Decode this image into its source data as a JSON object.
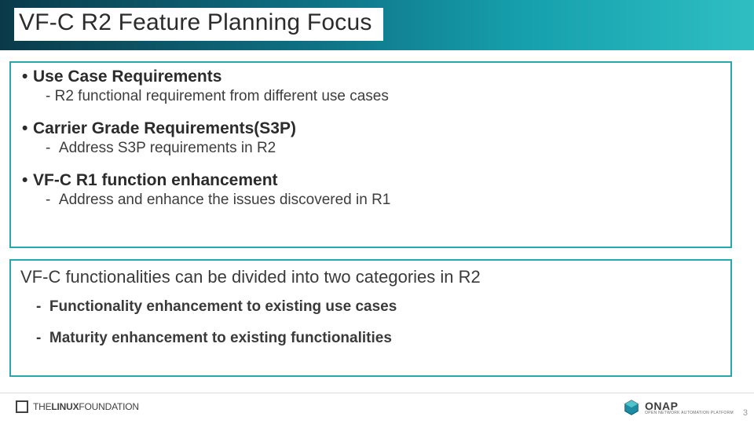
{
  "title": "VF-C R2 Feature Planning Focus",
  "sections": [
    {
      "heading": "Use Case Requirements",
      "sub": "R2 functional requirement from different use cases"
    },
    {
      "heading": "Carrier Grade Requirements(S3P)",
      "sub": "Address S3P requirements in R2"
    },
    {
      "heading": "VF-C R1 function enhancement",
      "sub": "Address and enhance the issues discovered in R1"
    }
  ],
  "categories": {
    "intro": "VF-C functionalities can be divided into two categories in R2",
    "items": [
      "Functionality enhancement to existing use cases",
      "Maturity enhancement to existing functionalities"
    ]
  },
  "footer": {
    "linux_thin": "THE",
    "linux_bold1": "LINUX",
    "linux_thin2": "FOUNDATION",
    "onap_main": "ONAP",
    "onap_sub": "OPEN NETWORK AUTOMATION PLATFORM",
    "page": "3"
  }
}
